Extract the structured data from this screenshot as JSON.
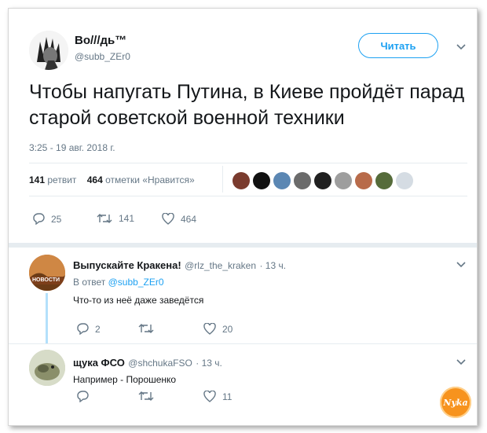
{
  "tweet": {
    "author_name": "Bo///дь™",
    "author_handle": "@subb_ZEr0",
    "follow_label": "Читать",
    "text": "Чтобы напугать Путина, в Киеве пройдёт парад старой советской военной техники",
    "timestamp": "3:25 - 19 авг. 2018 г.",
    "retweets_count": "141",
    "retweets_label": "ретвит",
    "likes_count": "464",
    "likes_label": "отметки «Нравится»",
    "actions": {
      "replies": "25",
      "retweets": "141",
      "likes": "464"
    }
  },
  "replies": [
    {
      "name": "Выпускайте Кракена!",
      "handle": "@rlz_the_kraken",
      "time": "· 13 ч.",
      "in_reply_prefix": "В ответ",
      "in_reply_handle": "@subb_ZEr0",
      "text": "Что-то из неё даже заведётся",
      "avatar_text": "НОВОСТИ",
      "actions": {
        "replies": "2",
        "retweets": "",
        "likes": "20"
      }
    },
    {
      "name": "щука ФСО",
      "handle": "@shchukaFSO",
      "time": "· 13 ч.",
      "text": "Например - Порошенко",
      "actions": {
        "replies": "",
        "retweets": "",
        "likes": "11"
      }
    }
  ],
  "watermark": {
    "text": "Nyka"
  },
  "colors": {
    "accent": "#1da1f2",
    "secondary_text": "#657786",
    "thread_line": "#b3e0fb",
    "watermark": "#f7931e"
  }
}
